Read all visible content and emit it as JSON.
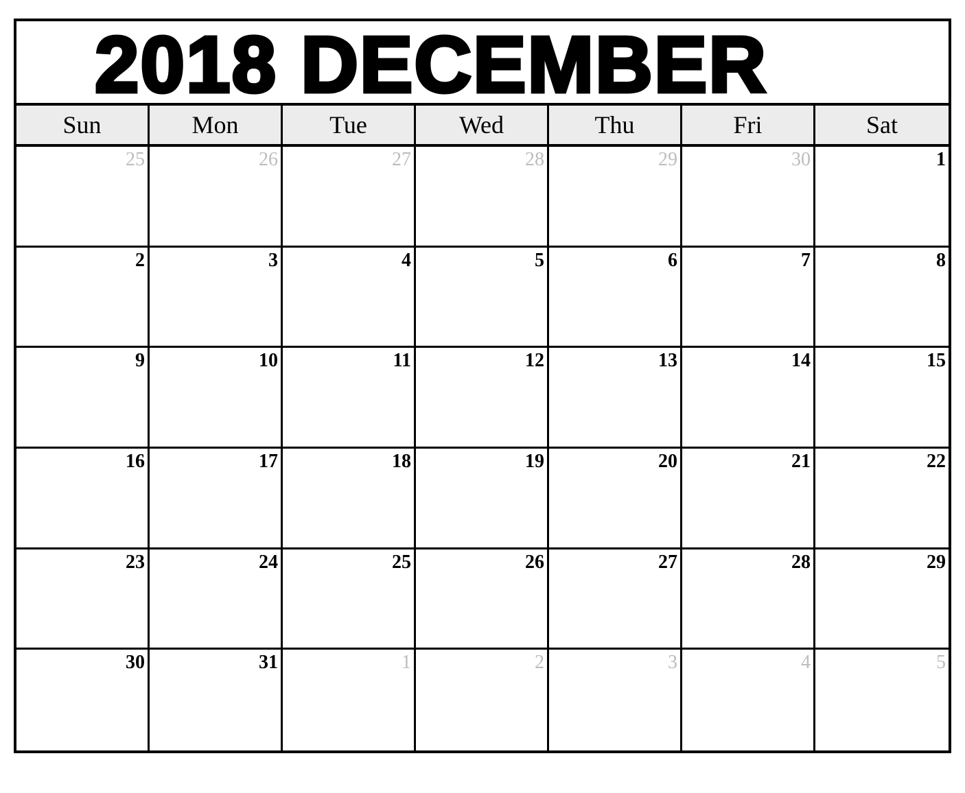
{
  "title": "2018 DECEMBER",
  "weekdays": [
    "Sun",
    "Mon",
    "Tue",
    "Wed",
    "Thu",
    "Fri",
    "Sat"
  ],
  "colors": {
    "border": "#000000",
    "header_bg": "#ececec",
    "other_month_text": "#bdbdbd",
    "current_month_text": "#000000"
  },
  "weeks": [
    [
      {
        "day": "25",
        "other": true
      },
      {
        "day": "26",
        "other": true
      },
      {
        "day": "27",
        "other": true
      },
      {
        "day": "28",
        "other": true
      },
      {
        "day": "29",
        "other": true
      },
      {
        "day": "30",
        "other": true
      },
      {
        "day": "1",
        "other": false
      }
    ],
    [
      {
        "day": "2",
        "other": false
      },
      {
        "day": "3",
        "other": false
      },
      {
        "day": "4",
        "other": false
      },
      {
        "day": "5",
        "other": false
      },
      {
        "day": "6",
        "other": false
      },
      {
        "day": "7",
        "other": false
      },
      {
        "day": "8",
        "other": false
      }
    ],
    [
      {
        "day": "9",
        "other": false
      },
      {
        "day": "10",
        "other": false
      },
      {
        "day": "11",
        "other": false
      },
      {
        "day": "12",
        "other": false
      },
      {
        "day": "13",
        "other": false
      },
      {
        "day": "14",
        "other": false
      },
      {
        "day": "15",
        "other": false
      }
    ],
    [
      {
        "day": "16",
        "other": false
      },
      {
        "day": "17",
        "other": false
      },
      {
        "day": "18",
        "other": false
      },
      {
        "day": "19",
        "other": false
      },
      {
        "day": "20",
        "other": false
      },
      {
        "day": "21",
        "other": false
      },
      {
        "day": "22",
        "other": false
      }
    ],
    [
      {
        "day": "23",
        "other": false
      },
      {
        "day": "24",
        "other": false
      },
      {
        "day": "25",
        "other": false
      },
      {
        "day": "26",
        "other": false
      },
      {
        "day": "27",
        "other": false
      },
      {
        "day": "28",
        "other": false
      },
      {
        "day": "29",
        "other": false
      }
    ],
    [
      {
        "day": "30",
        "other": false
      },
      {
        "day": "31",
        "other": false
      },
      {
        "day": "1",
        "other": true
      },
      {
        "day": "2",
        "other": true
      },
      {
        "day": "3",
        "other": true
      },
      {
        "day": "4",
        "other": true
      },
      {
        "day": "5",
        "other": true
      }
    ]
  ]
}
